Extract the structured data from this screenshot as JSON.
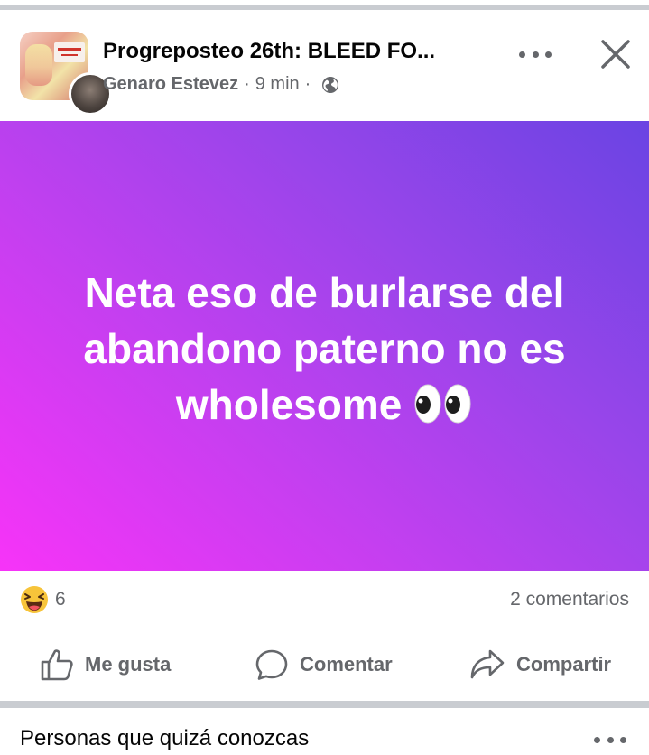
{
  "post": {
    "title": "Progreposteo 26th: BLEED FO...",
    "author": "Genaro Estevez",
    "time": "9 min",
    "separator": "·",
    "privacy_icon": "globe-icon",
    "banner_text": "Neta eso de burlarse del abandono paterno no es wholesome",
    "banner_emoji": "eyes-emoji",
    "banner_gradient": [
      "#f733f8",
      "#6a44e3"
    ]
  },
  "reactions": {
    "emoji": "laughing-emoji",
    "count": "6",
    "comments": "2 comentarios"
  },
  "actions": {
    "like": "Me gusta",
    "comment": "Comentar",
    "share": "Compartir"
  },
  "suggestions": {
    "title": "Personas que quizá conozcas"
  },
  "colors": {
    "secondary_text": "#65676b",
    "divider": "#c9ccd1"
  }
}
